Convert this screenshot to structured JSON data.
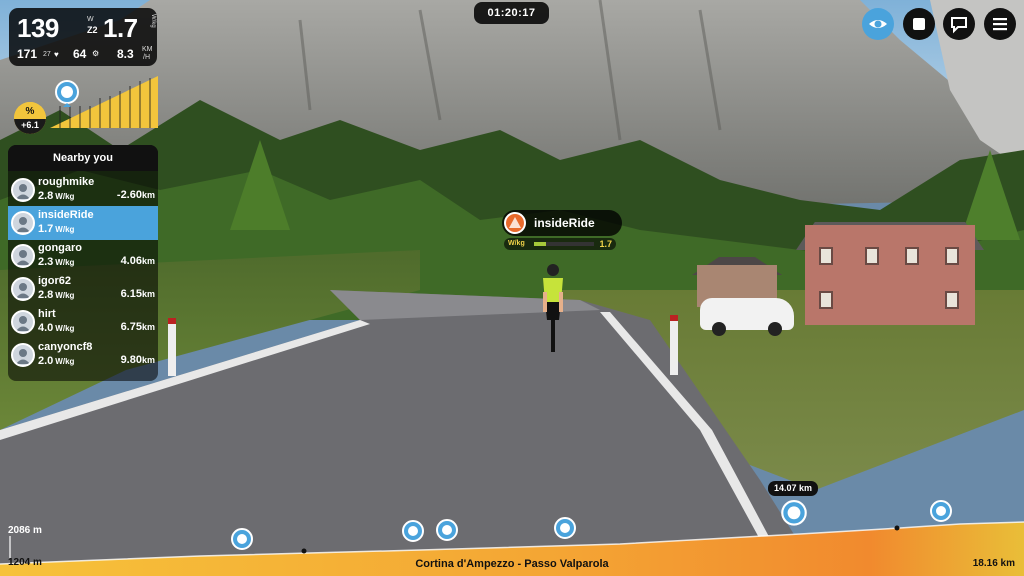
{
  "hud": {
    "power": "139",
    "power_unit": "W",
    "zone": "Z2",
    "wkg": "1.7",
    "wkg_unit": "W/kg",
    "cadence": "171",
    "cadence_sub": "27",
    "heart_icon": "heart-icon",
    "speed": "64",
    "speed_icon": "gear-icon",
    "distance": "8.3",
    "distance_unit_top": "KM",
    "distance_unit_bottom": "/H"
  },
  "grade": {
    "symbol": "%",
    "value": "+6.1"
  },
  "timer": "01:20:17",
  "toolbar": {
    "buttons": [
      "eye-icon",
      "stop-icon",
      "chat-icon",
      "menu-icon"
    ],
    "accent": "#4aa3dc"
  },
  "nearby": {
    "title": "Nearby you",
    "riders": [
      {
        "name": "roughmike",
        "wkg": "2.8",
        "wkg_unit": "W/kg",
        "dist": "-2.60",
        "dist_unit": "km",
        "active": false
      },
      {
        "name": "insideRide",
        "wkg": "1.7",
        "wkg_unit": "W/kg",
        "dist": "",
        "dist_unit": "",
        "active": true
      },
      {
        "name": "gongaro",
        "wkg": "2.3",
        "wkg_unit": "W/kg",
        "dist": "4.06",
        "dist_unit": "km",
        "active": false
      },
      {
        "name": "igor62",
        "wkg": "2.8",
        "wkg_unit": "W/kg",
        "dist": "6.15",
        "dist_unit": "km",
        "active": false
      },
      {
        "name": "hirt",
        "wkg": "4.0",
        "wkg_unit": "W/kg",
        "dist": "6.75",
        "dist_unit": "km",
        "active": false
      },
      {
        "name": "canyoncf8",
        "wkg": "2.0",
        "wkg_unit": "W/kg",
        "dist": "9.80",
        "dist_unit": "km",
        "active": false
      }
    ]
  },
  "rider_tag": {
    "name": "insideRide",
    "label": "W/kg",
    "value": "1.7",
    "fill_fraction": 0.2
  },
  "profile": {
    "max_alt": "2086 m",
    "min_alt": "1204 m",
    "route_name": "Cortina d'Ampezzo - Passo Valparola",
    "total": "18.16 km",
    "current_position": "14.07 km"
  }
}
